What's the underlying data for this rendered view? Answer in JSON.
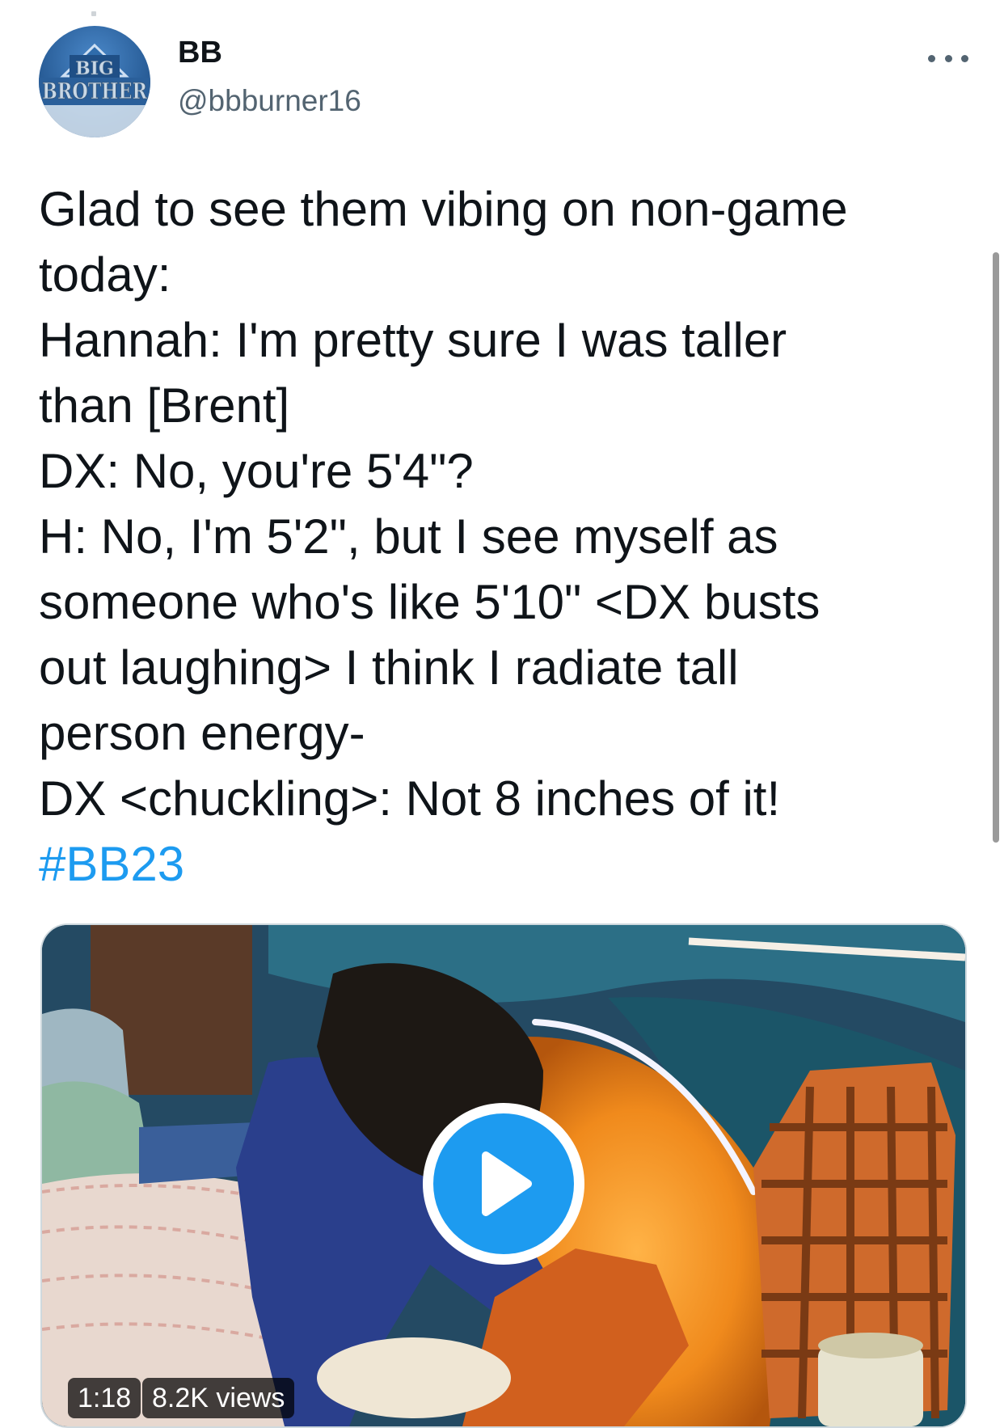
{
  "tweet": {
    "author": {
      "display_name": "BB",
      "handle": "@bbburner16",
      "avatar_logo_text": [
        "BIG",
        "BROTHER"
      ]
    },
    "more_icon": "more-horizontal-icon",
    "text_lines": [
      "Glad to see them vibing on non-game",
      "today:",
      "Hannah: I'm pretty sure I was taller",
      "than [Brent]",
      "DX: No, you're 5'4\"?",
      "H: No, I'm 5'2\", but I see myself as",
      "someone who's like 5'10\" <DX busts",
      "out laughing> I think I radiate tall",
      "person energy-",
      "DX <chuckling>: Not 8 inches of it!"
    ],
    "hashtag": "#BB23",
    "video": {
      "duration": "1:18",
      "views": "8.2K views",
      "play_icon": "play-icon"
    }
  },
  "colors": {
    "link": "#1d9bf0",
    "secondary_text": "#536471",
    "primary_text": "#0f1419",
    "play_button": "#1d9bf0"
  }
}
